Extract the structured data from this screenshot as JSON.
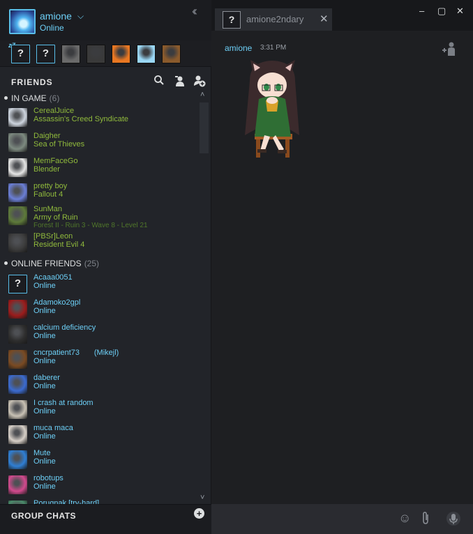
{
  "user": {
    "name": "amione",
    "status": "Online"
  },
  "recent_chats": [
    {
      "kind": "question",
      "glyph": "?"
    },
    {
      "kind": "question",
      "glyph": "?"
    },
    {
      "kind": "avatar",
      "color": "#6a6a6a"
    },
    {
      "kind": "avatar",
      "color": "#3a3a3a"
    },
    {
      "kind": "avatar",
      "color": "#e87722"
    },
    {
      "kind": "avatar",
      "color": "#9ad7f5"
    },
    {
      "kind": "avatar",
      "color": "#8a5a2c"
    }
  ],
  "friends_header": {
    "title": "FRIENDS"
  },
  "in_game": {
    "label": "IN GAME",
    "count": "(6)",
    "friends": [
      {
        "name": "CerealJuice",
        "game": "Assassin's Creed Syndicate",
        "extra": "",
        "color": "#cfd6e0"
      },
      {
        "name": "Daigher",
        "game": "Sea of Thieves",
        "extra": "",
        "color": "#7d8a80"
      },
      {
        "name": "MemFaceGo",
        "game": "Blender",
        "extra": "",
        "color": "#e6e6e6"
      },
      {
        "name": "pretty boy",
        "game": "Fallout 4",
        "extra": "",
        "color": "#6b7fd7"
      },
      {
        "name": "SunMan",
        "game": "Army of Ruin",
        "extra": "Forest II - Ruin 3 - Wave 8 - Level 21",
        "color": "#5e7a3a"
      },
      {
        "name": "[PBSr]Leon",
        "game": "Resident Evil 4",
        "extra": "",
        "color": "#3c3c3c"
      }
    ]
  },
  "online": {
    "label": "ONLINE FRIENDS",
    "count": "(25)",
    "friends": [
      {
        "name": "Acaaa0051",
        "status": "Online",
        "nickname": "",
        "color": "question"
      },
      {
        "name": "Adamoko2gpl",
        "status": "Online",
        "nickname": "",
        "color": "#9b1b1b"
      },
      {
        "name": "calcium deficiency",
        "status": "Online",
        "nickname": "",
        "color": "#2e2e2e"
      },
      {
        "name": "cncrpatient73",
        "status": "Online",
        "nickname": "(Mikejl)",
        "color": "#7a4a22"
      },
      {
        "name": "daberer",
        "status": "Online",
        "nickname": "",
        "color": "#3b6bd0"
      },
      {
        "name": "I crash at random",
        "status": "Online",
        "nickname": "",
        "color": "#c9c2b5"
      },
      {
        "name": "muca maca",
        "status": "Online",
        "nickname": "",
        "color": "#d7d0c8"
      },
      {
        "name": "Mute",
        "status": "Online",
        "nickname": "",
        "color": "#2f7fd4"
      },
      {
        "name": "robotups",
        "status": "Online",
        "nickname": "",
        "color": "#d24a8e"
      },
      {
        "name": "Porugnak [try-hard]",
        "status": "",
        "nickname": "",
        "color": "#4a8a6a"
      }
    ]
  },
  "group_chats": {
    "label": "GROUP CHATS"
  },
  "chat": {
    "tab_name": "amione2ndary",
    "message_author": "amione",
    "message_time": "3:31 PM"
  }
}
